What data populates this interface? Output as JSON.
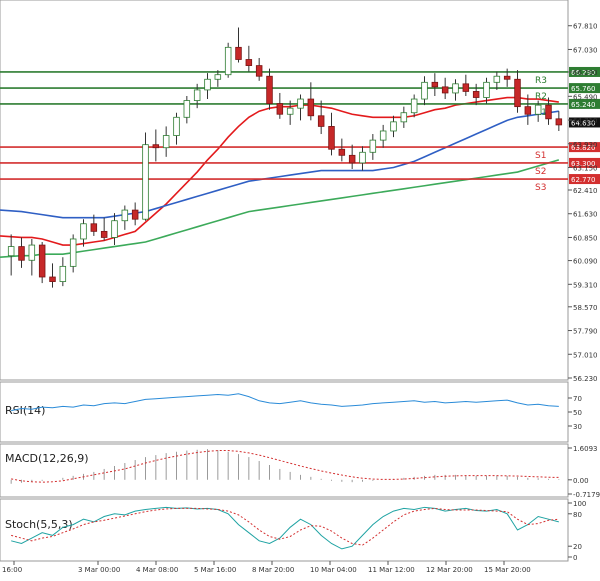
{
  "chart_data": {
    "type": "candlestick",
    "price_axis": {
      "min": 56.23,
      "max": 68.59,
      "ticks": [
        "67.810",
        "67.030",
        "66.290",
        "65.490",
        "64.710",
        "63.930",
        "63.150",
        "62.410",
        "61.630",
        "60.850",
        "60.090",
        "59.310",
        "58.570",
        "57.790",
        "57.010",
        "56.230"
      ]
    },
    "x_ticks": [
      "16:00",
      "3 Mar 00:00",
      "4 Mar 08:00",
      "5 Mar 16:00",
      "8 Mar 20:00",
      "10 Mar 04:00",
      "11 Mar 12:00",
      "12 Mar 20:00",
      "15 Mar 20:00"
    ],
    "candles": [
      {
        "o": 60.25,
        "h": 60.95,
        "l": 59.6,
        "c": 60.55
      },
      {
        "o": 60.55,
        "h": 60.85,
        "l": 59.85,
        "c": 60.1
      },
      {
        "o": 60.1,
        "h": 60.8,
        "l": 59.6,
        "c": 60.6
      },
      {
        "o": 60.6,
        "h": 60.7,
        "l": 59.35,
        "c": 59.55
      },
      {
        "o": 59.55,
        "h": 60.0,
        "l": 59.2,
        "c": 59.4
      },
      {
        "o": 59.4,
        "h": 60.2,
        "l": 59.25,
        "c": 59.9
      },
      {
        "o": 59.9,
        "h": 60.95,
        "l": 59.7,
        "c": 60.8
      },
      {
        "o": 60.8,
        "h": 61.45,
        "l": 60.55,
        "c": 61.3
      },
      {
        "o": 61.3,
        "h": 61.6,
        "l": 60.9,
        "c": 61.05
      },
      {
        "o": 61.05,
        "h": 61.5,
        "l": 60.75,
        "c": 60.85
      },
      {
        "o": 60.85,
        "h": 61.65,
        "l": 60.6,
        "c": 61.4
      },
      {
        "o": 61.4,
        "h": 61.9,
        "l": 61.1,
        "c": 61.75
      },
      {
        "o": 61.75,
        "h": 62.0,
        "l": 61.25,
        "c": 61.45
      },
      {
        "o": 61.45,
        "h": 64.3,
        "l": 61.4,
        "c": 63.9
      },
      {
        "o": 63.9,
        "h": 64.4,
        "l": 63.35,
        "c": 63.8
      },
      {
        "o": 63.8,
        "h": 64.5,
        "l": 63.5,
        "c": 64.2
      },
      {
        "o": 64.2,
        "h": 64.95,
        "l": 63.9,
        "c": 64.8
      },
      {
        "o": 64.8,
        "h": 65.5,
        "l": 64.6,
        "c": 65.35
      },
      {
        "o": 65.35,
        "h": 65.9,
        "l": 65.1,
        "c": 65.7
      },
      {
        "o": 65.7,
        "h": 66.25,
        "l": 65.4,
        "c": 66.05
      },
      {
        "o": 66.05,
        "h": 66.35,
        "l": 65.8,
        "c": 66.2
      },
      {
        "o": 66.2,
        "h": 67.25,
        "l": 66.1,
        "c": 67.1
      },
      {
        "o": 67.1,
        "h": 67.75,
        "l": 66.6,
        "c": 66.7
      },
      {
        "o": 66.7,
        "h": 67.15,
        "l": 66.3,
        "c": 66.5
      },
      {
        "o": 66.5,
        "h": 66.75,
        "l": 66.0,
        "c": 66.15
      },
      {
        "o": 66.15,
        "h": 66.4,
        "l": 65.05,
        "c": 65.25
      },
      {
        "o": 65.25,
        "h": 65.6,
        "l": 64.75,
        "c": 64.9
      },
      {
        "o": 64.9,
        "h": 65.35,
        "l": 64.55,
        "c": 65.1
      },
      {
        "o": 65.1,
        "h": 65.55,
        "l": 64.7,
        "c": 65.4
      },
      {
        "o": 65.4,
        "h": 65.95,
        "l": 64.7,
        "c": 64.85
      },
      {
        "o": 64.85,
        "h": 65.35,
        "l": 64.25,
        "c": 64.5
      },
      {
        "o": 64.5,
        "h": 64.95,
        "l": 63.55,
        "c": 63.75
      },
      {
        "o": 63.75,
        "h": 64.1,
        "l": 63.35,
        "c": 63.55
      },
      {
        "o": 63.55,
        "h": 63.9,
        "l": 63.1,
        "c": 63.3
      },
      {
        "o": 63.3,
        "h": 63.85,
        "l": 63.05,
        "c": 63.65
      },
      {
        "o": 63.65,
        "h": 64.25,
        "l": 63.4,
        "c": 64.05
      },
      {
        "o": 64.05,
        "h": 64.55,
        "l": 63.8,
        "c": 64.35
      },
      {
        "o": 64.35,
        "h": 64.85,
        "l": 64.15,
        "c": 64.65
      },
      {
        "o": 64.65,
        "h": 65.15,
        "l": 64.45,
        "c": 64.95
      },
      {
        "o": 64.95,
        "h": 65.55,
        "l": 64.8,
        "c": 65.4
      },
      {
        "o": 65.4,
        "h": 66.15,
        "l": 65.2,
        "c": 65.95
      },
      {
        "o": 65.95,
        "h": 66.25,
        "l": 65.5,
        "c": 65.8
      },
      {
        "o": 65.8,
        "h": 66.1,
        "l": 65.4,
        "c": 65.6
      },
      {
        "o": 65.6,
        "h": 66.05,
        "l": 65.35,
        "c": 65.9
      },
      {
        "o": 65.9,
        "h": 66.2,
        "l": 65.5,
        "c": 65.65
      },
      {
        "o": 65.65,
        "h": 65.9,
        "l": 65.2,
        "c": 65.45
      },
      {
        "o": 65.45,
        "h": 66.1,
        "l": 65.25,
        "c": 65.95
      },
      {
        "o": 65.95,
        "h": 66.3,
        "l": 65.7,
        "c": 66.15
      },
      {
        "o": 66.15,
        "h": 66.4,
        "l": 65.8,
        "c": 66.05
      },
      {
        "o": 66.05,
        "h": 66.35,
        "l": 64.95,
        "c": 65.15
      },
      {
        "o": 65.15,
        "h": 65.55,
        "l": 64.55,
        "c": 64.9
      },
      {
        "o": 64.9,
        "h": 65.35,
        "l": 64.65,
        "c": 65.2
      },
      {
        "o": 65.2,
        "h": 65.45,
        "l": 64.55,
        "c": 64.75
      },
      {
        "o": 64.75,
        "h": 65.0,
        "l": 64.35,
        "c": 64.55
      }
    ],
    "moving_averages": [
      {
        "color": "#e31a1c",
        "values": [
          60.9,
          60.85,
          60.85,
          60.8,
          60.7,
          60.6,
          60.6,
          60.65,
          60.7,
          60.75,
          60.85,
          60.95,
          61.05,
          61.35,
          61.65,
          61.95,
          62.3,
          62.65,
          63.0,
          63.4,
          63.75,
          64.15,
          64.5,
          64.8,
          65.0,
          65.1,
          65.15,
          65.15,
          65.2,
          65.2,
          65.15,
          65.1,
          65.0,
          64.9,
          64.85,
          64.8,
          64.8,
          64.8,
          64.8,
          64.85,
          64.95,
          65.05,
          65.1,
          65.2,
          65.25,
          65.3,
          65.35,
          65.4,
          65.45,
          65.45,
          65.4,
          65.4,
          65.35,
          65.3
        ]
      },
      {
        "color": "#2f5fc4",
        "values": [
          61.75,
          61.7,
          61.65,
          61.6,
          61.55,
          61.5,
          61.5,
          61.5,
          61.5,
          61.5,
          61.55,
          61.6,
          61.65,
          61.7,
          61.8,
          61.9,
          62.0,
          62.1,
          62.2,
          62.3,
          62.4,
          62.5,
          62.6,
          62.7,
          62.75,
          62.8,
          62.85,
          62.9,
          62.95,
          63.0,
          63.05,
          63.05,
          63.05,
          63.05,
          63.05,
          63.05,
          63.1,
          63.15,
          63.25,
          63.35,
          63.5,
          63.65,
          63.8,
          63.95,
          64.1,
          64.25,
          64.4,
          64.55,
          64.7,
          64.8,
          64.85,
          64.9,
          64.95,
          65.0
        ]
      },
      {
        "color": "#3caa5a",
        "values": [
          60.2,
          60.25,
          60.25,
          60.3,
          60.3,
          60.3,
          60.35,
          60.4,
          60.45,
          60.5,
          60.55,
          60.6,
          60.65,
          60.7,
          60.8,
          60.9,
          61.0,
          61.1,
          61.2,
          61.3,
          61.4,
          61.5,
          61.6,
          61.7,
          61.75,
          61.8,
          61.85,
          61.9,
          61.95,
          62.0,
          62.05,
          62.1,
          62.15,
          62.2,
          62.25,
          62.3,
          62.35,
          62.4,
          62.45,
          62.5,
          62.55,
          62.6,
          62.65,
          62.7,
          62.75,
          62.8,
          62.85,
          62.9,
          62.95,
          63.0,
          63.1,
          63.2,
          63.3,
          63.4
        ]
      }
    ],
    "levels": [
      {
        "label": "R3",
        "value": 66.29,
        "tag": "66.290",
        "color": "#2e7d32"
      },
      {
        "label": "R2",
        "value": 65.76,
        "tag": "65.760",
        "color": "#2e7d32"
      },
      {
        "label": "R1",
        "value": 65.24,
        "tag": "65.240",
        "color": "#2e7d32"
      },
      {
        "label": "S1",
        "value": 63.82,
        "tag": "63.820",
        "color": "#d32f2f"
      },
      {
        "label": "S2",
        "value": 63.3,
        "tag": "63.300",
        "color": "#d32f2f"
      },
      {
        "label": "S3",
        "value": 62.77,
        "tag": "62.770",
        "color": "#d32f2f"
      }
    ],
    "current_price": {
      "value": 64.63,
      "tag": "64.630"
    },
    "indicators": {
      "rsi": {
        "label": "RSI(14)",
        "ticks": [
          "70",
          "50",
          "30"
        ],
        "range": [
          10,
          90
        ],
        "values": [
          52,
          55,
          54,
          57,
          56,
          58,
          57,
          60,
          59,
          62,
          63,
          62,
          65,
          68,
          69,
          70,
          71,
          72,
          73,
          74,
          75,
          74,
          76,
          72,
          66,
          63,
          62,
          64,
          66,
          63,
          61,
          60,
          58,
          59,
          60,
          62,
          63,
          64,
          65,
          66,
          64,
          65,
          63,
          64,
          65,
          64,
          65,
          66,
          67,
          63,
          60,
          61,
          59,
          58
        ]
      },
      "macd": {
        "label": "MACD(12,26,9)",
        "ticks": [
          "1.6093",
          "0.00",
          "-0.7179"
        ],
        "range": [
          -0.7179,
          1.6093
        ],
        "hist": [
          -0.2,
          -0.15,
          -0.1,
          -0.05,
          0.0,
          0.1,
          0.2,
          0.3,
          0.4,
          0.55,
          0.7,
          0.85,
          1.0,
          1.15,
          1.25,
          1.35,
          1.42,
          1.48,
          1.52,
          1.55,
          1.5,
          1.42,
          1.3,
          1.15,
          0.95,
          0.75,
          0.55,
          0.4,
          0.25,
          0.15,
          0.05,
          -0.05,
          -0.1,
          -0.12,
          -0.1,
          -0.05,
          0.0,
          0.05,
          0.1,
          0.15,
          0.2,
          0.25,
          0.25,
          0.25,
          0.22,
          0.2,
          0.2,
          0.22,
          0.2,
          0.15,
          0.1,
          0.08,
          0.05,
          0.03
        ],
        "signal": [
          0.05,
          -0.05,
          -0.1,
          -0.12,
          -0.1,
          -0.05,
          0.05,
          0.15,
          0.25,
          0.35,
          0.45,
          0.55,
          0.7,
          0.85,
          0.98,
          1.1,
          1.2,
          1.3,
          1.38,
          1.44,
          1.48,
          1.48,
          1.44,
          1.36,
          1.25,
          1.12,
          0.98,
          0.84,
          0.7,
          0.57,
          0.45,
          0.34,
          0.24,
          0.15,
          0.08,
          0.04,
          0.02,
          0.02,
          0.04,
          0.07,
          0.11,
          0.15,
          0.18,
          0.2,
          0.21,
          0.21,
          0.21,
          0.21,
          0.2,
          0.19,
          0.17,
          0.15,
          0.13,
          0.12
        ]
      },
      "stoch": {
        "label": "Stoch(5,5,3)",
        "ticks": [
          "100",
          "80",
          "20",
          "0"
        ],
        "range": [
          0,
          100
        ],
        "k": [
          30,
          25,
          35,
          45,
          40,
          55,
          60,
          70,
          65,
          75,
          80,
          78,
          85,
          88,
          90,
          92,
          90,
          91,
          89,
          90,
          88,
          80,
          60,
          45,
          30,
          25,
          35,
          55,
          70,
          60,
          40,
          25,
          15,
          20,
          40,
          60,
          75,
          85,
          90,
          88,
          92,
          90,
          85,
          88,
          90,
          86,
          85,
          88,
          80,
          50,
          60,
          75,
          70,
          65
        ],
        "d": [
          40,
          35,
          30,
          35,
          38,
          45,
          52,
          60,
          65,
          68,
          72,
          76,
          80,
          84,
          87,
          89,
          90,
          90,
          90,
          89,
          88,
          85,
          78,
          65,
          50,
          38,
          33,
          38,
          50,
          58,
          57,
          48,
          35,
          25,
          22,
          35,
          50,
          65,
          78,
          85,
          88,
          90,
          88,
          87,
          87,
          87,
          86,
          85,
          84,
          70,
          60,
          62,
          68,
          70
        ]
      }
    }
  }
}
